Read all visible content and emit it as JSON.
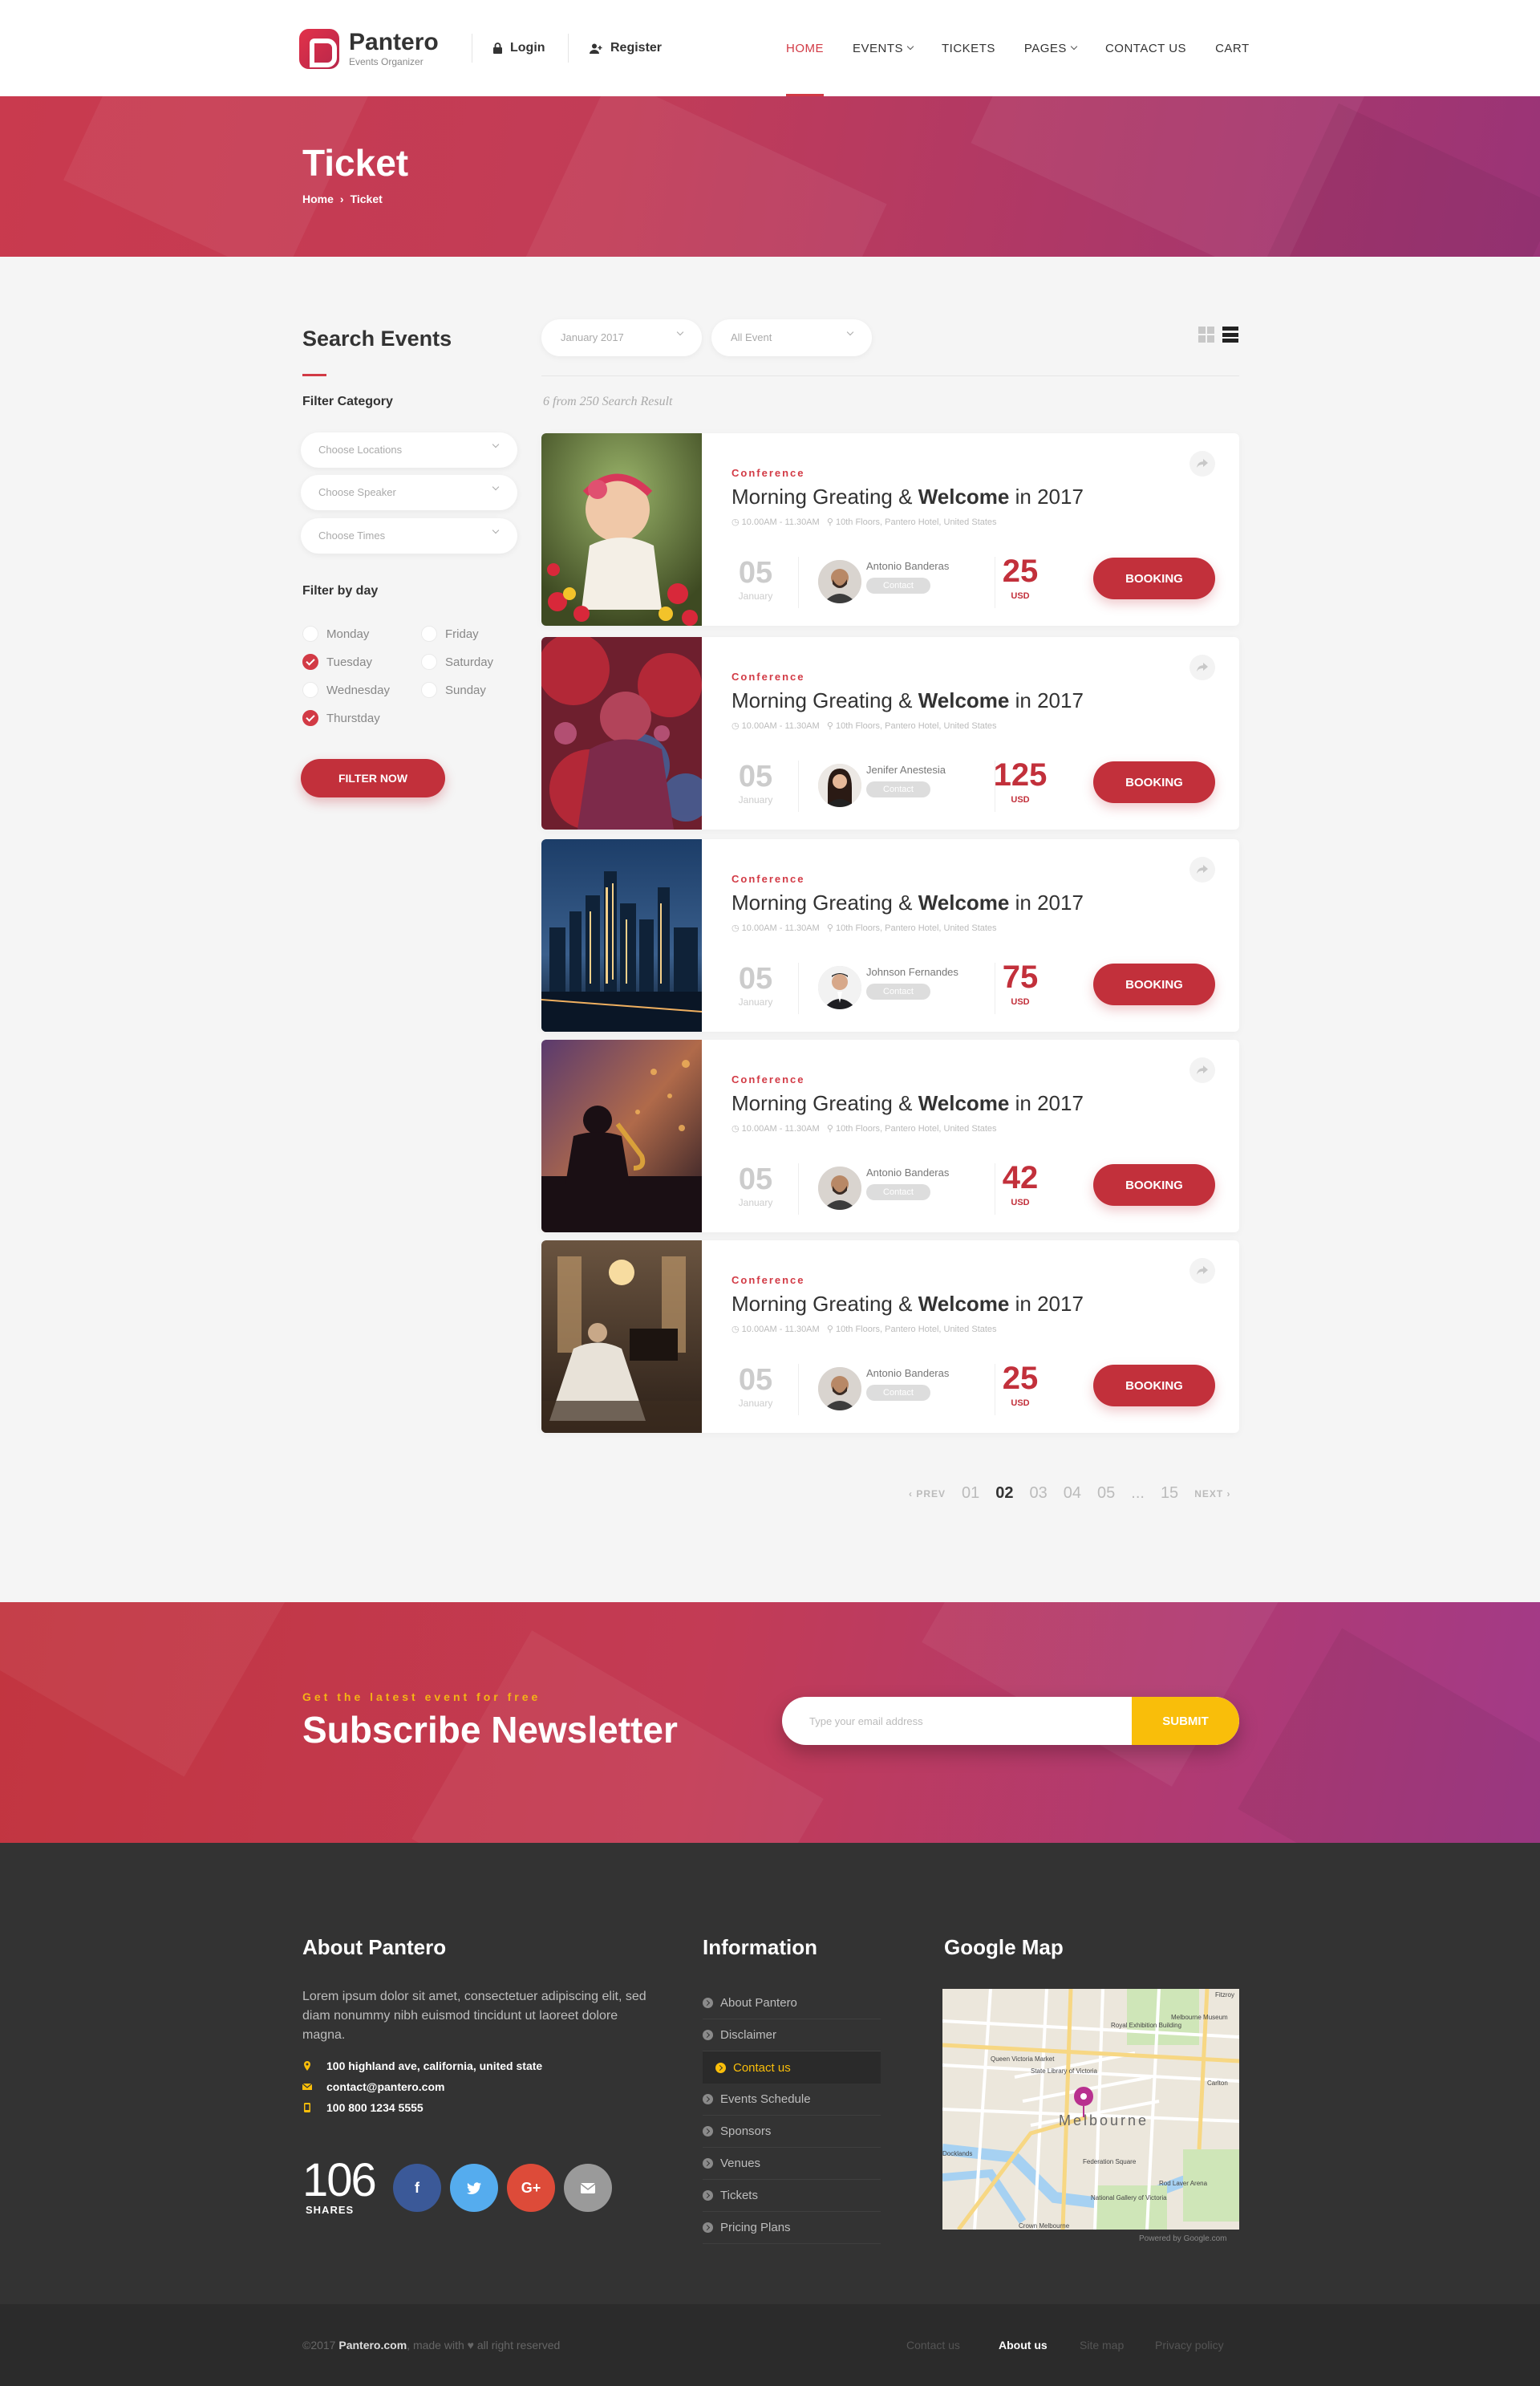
{
  "brand": {
    "name": "Pantero",
    "tagline": "Events Organizer"
  },
  "account": {
    "login": "Login",
    "register": "Register"
  },
  "nav": [
    {
      "label": "HOME",
      "active": true,
      "dropdown": false
    },
    {
      "label": "EVENTS",
      "active": false,
      "dropdown": true
    },
    {
      "label": "TICKETS",
      "active": false,
      "dropdown": false
    },
    {
      "label": "PAGES",
      "active": false,
      "dropdown": true
    },
    {
      "label": "CONTACT US",
      "active": false,
      "dropdown": false
    },
    {
      "label": "CART",
      "active": false,
      "dropdown": false
    }
  ],
  "hero": {
    "title": "Ticket",
    "breadcrumb": [
      "Home",
      "Ticket"
    ]
  },
  "sidebar": {
    "title": "Search Events",
    "filter_category": "Filter Category",
    "selects": [
      "Choose Locations",
      "Choose Speaker",
      "Choose Times"
    ],
    "filter_by_day": "Filter by day",
    "days": [
      {
        "label": "Monday",
        "checked": false
      },
      {
        "label": "Tuesday",
        "checked": true
      },
      {
        "label": "Wednesday",
        "checked": false
      },
      {
        "label": "Thurstday",
        "checked": true
      },
      {
        "label": "Friday",
        "checked": false
      },
      {
        "label": "Saturday",
        "checked": false
      },
      {
        "label": "Sunday",
        "checked": false
      }
    ],
    "filter_button": "FILTER NOW"
  },
  "toolbar": {
    "month": "January 2017",
    "event_type": "All Event"
  },
  "result_text": "6 from 250 Search Result",
  "events": [
    {
      "category": "Conference",
      "title_pre": "Morning Greating &",
      "title_bold": "Welcome",
      "title_post": "in 2017",
      "time": "10.00AM - 11.30AM",
      "location": "10th Floors, Pantero Hotel, United States",
      "day": "05",
      "month": "January",
      "speaker": "Antonio Banderas",
      "contact": "Contact",
      "price": "25",
      "currency": "USD",
      "booking": "BOOKING",
      "image": "baby-in-flowers",
      "avatar": "man-beard"
    },
    {
      "category": "Conference",
      "title_pre": "Morning Greating &",
      "title_bold": "Welcome",
      "title_post": "in 2017",
      "time": "10.00AM - 11.30AM",
      "location": "10th Floors, Pantero Hotel, United States",
      "day": "05",
      "month": "January",
      "speaker": "Jenifer Anestesia",
      "contact": "Contact",
      "price": "125",
      "currency": "USD",
      "booking": "BOOKING",
      "image": "color-festival",
      "avatar": "woman"
    },
    {
      "category": "Conference",
      "title_pre": "Morning Greating &",
      "title_bold": "Welcome",
      "title_post": "in 2017",
      "time": "10.00AM - 11.30AM",
      "location": "10th Floors, Pantero Hotel, United States",
      "day": "05",
      "month": "January",
      "speaker": "Johnson Fernandes",
      "contact": "Contact",
      "price": "75",
      "currency": "USD",
      "booking": "BOOKING",
      "image": "city-skyline-night",
      "avatar": "man-suit"
    },
    {
      "category": "Conference",
      "title_pre": "Morning Greating &",
      "title_bold": "Welcome",
      "title_post": "in 2017",
      "time": "10.00AM - 11.30AM",
      "location": "10th Floors, Pantero Hotel, United States",
      "day": "05",
      "month": "January",
      "speaker": "Antonio Banderas",
      "contact": "Contact",
      "price": "42",
      "currency": "USD",
      "booking": "BOOKING",
      "image": "saxophone-player",
      "avatar": "man-beard"
    },
    {
      "category": "Conference",
      "title_pre": "Morning Greating &",
      "title_bold": "Welcome",
      "title_post": "in 2017",
      "time": "10.00AM - 11.30AM",
      "location": "10th Floors, Pantero Hotel, United States",
      "day": "05",
      "month": "January",
      "speaker": "Antonio Banderas",
      "contact": "Contact",
      "price": "25",
      "currency": "USD",
      "booking": "BOOKING",
      "image": "pianist-hall",
      "avatar": "man-beard"
    }
  ],
  "pagination": {
    "prev": "‹ PREV",
    "pages": [
      "01",
      "02",
      "03",
      "04",
      "05",
      "...",
      "15"
    ],
    "active": "02",
    "next": "NEXT ›"
  },
  "newsletter": {
    "kicker": "Get the latest event for free",
    "title": "Subscribe Newsletter",
    "placeholder": "Type your email address",
    "button": "SUBMIT"
  },
  "footer": {
    "about_title": "About Pantero",
    "about_text": "Lorem ipsum dolor sit amet, consectetuer adipiscing elit, sed diam nonummy nibh euismod tincidunt ut laoreet dolore magna.",
    "address": "100 highland ave, california, united state",
    "email": "contact@pantero.com",
    "phone": "100 800 1234 5555",
    "shares_count": "106",
    "shares_label": "SHARES",
    "social": [
      "f",
      "twitter",
      "G+",
      "mail"
    ],
    "info_title": "Information",
    "info_links": [
      "About Pantero",
      "Disclaimer",
      "Contact us",
      "Events Schedule",
      "Sponsors",
      "Venues",
      "Tickets",
      "Pricing Plans"
    ],
    "info_active": "Contact us",
    "map_title": "Google Map",
    "map_labels": [
      "Melbourne",
      "Queen Victoria Market",
      "State Library of Victoria",
      "Royal Exhibition Building",
      "Melbourne Museum",
      "Federation Square",
      "National Gallery of Victoria",
      "Docklands",
      "Crown Melbourne",
      "Rod Laver Arena",
      "Carlton",
      "Fitzroy"
    ],
    "map_credit": "Powered by Google.com"
  },
  "bottom": {
    "copyright_pre": "©2017",
    "copyright_brand": "Pantero.com",
    "copyright_post": ", made with ♥ all right reserved",
    "links": [
      "Contact us",
      "About us",
      "Site map",
      "Privacy policy"
    ],
    "active_link": "About us"
  },
  "colors": {
    "accent": "#c2303b",
    "yellow": "#f9be0a",
    "footer": "#333333",
    "facebook": "#3b5998",
    "twitter": "#55acee",
    "googleplus": "#dd4b39",
    "mail": "#9a9a9a"
  }
}
